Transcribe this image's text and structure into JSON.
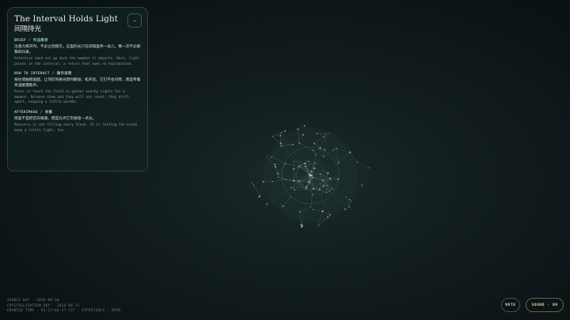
{
  "panel": {
    "title_en": "The Interval Holds Light",
    "title_zh": "间隔持光",
    "toggle_label": "—",
    "brief": {
      "heading": "BRIEF / 作品简述",
      "zh": "注意力离开时，不必立刻熄灭。这里的光只在间隔里停一会儿，像一次不必解释的归来。",
      "en": "Attention need not go dark the moment it departs. Here, light pauses in the interval: a return that owes no explanation."
    },
    "interact": {
      "heading": "HOW TO INTERACT / 操作说明",
      "zh": "按住或触摸画面，让邻近的微光暂时聚拢；松开后，它们不会归零，而是带着余温缓慢散开。",
      "en": "Press or touch the field to gather nearby lights for a moment. Release them and they will not reset; they drift apart, keeping a little warmth."
    },
    "afterimage": {
      "heading": "AFTERIMAGE / 余像",
      "zh": "恢复不是把空白填满，而是允许它仍保留一点光。",
      "en": "Recovery is not filling every blank. It is letting the blank keep a little light, too."
    }
  },
  "footer": {
    "line1": "SOURCE DAY · 2026-08-10",
    "line2": "CRYSTALLIZATION DAY · 2026-08-11",
    "line3": "GRANTED TIME · 03:17–04:17 CST · EXPERIENCE · OPEN"
  },
  "controls": {
    "note_label": "NOTE",
    "sound_label": "SOUND · ON"
  },
  "colors": {
    "particle": "#d8cf9a",
    "link": "#8fb8aa",
    "ring": "#6f9c92"
  }
}
